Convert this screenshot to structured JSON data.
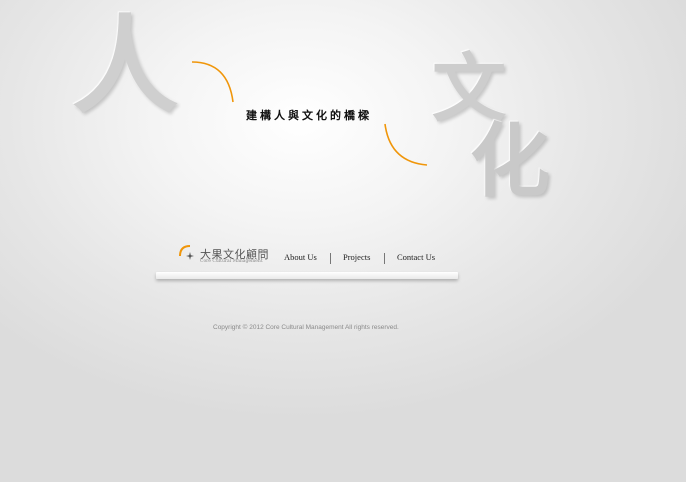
{
  "decoration": {
    "char_1": "人",
    "char_2": "文",
    "char_3": "化"
  },
  "tagline": "建構人與文化的橋樑",
  "logo": {
    "name": "大果文化顧問",
    "subtitle": "Core Cultural Management",
    "icon": "core-logo-icon",
    "accent_color": "#f0960a"
  },
  "nav": {
    "about": "About Us",
    "projects": "Projects",
    "contact": "Contact Us"
  },
  "footer": {
    "copyright": "Copyright © 2012 Core Cultural Management All rights reserved."
  }
}
